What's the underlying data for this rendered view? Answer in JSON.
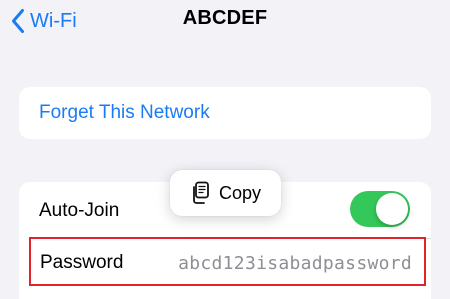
{
  "nav": {
    "back_label": "Wi-Fi",
    "title": "ABCDEF"
  },
  "forget": {
    "label": "Forget This Network"
  },
  "settings": {
    "auto_join_label": "Auto-Join",
    "auto_join_enabled": true,
    "password_label": "Password",
    "password_value": "abcd123isabadpassword"
  },
  "popover": {
    "copy_label": "Copy",
    "icon": "copy-icon"
  },
  "colors": {
    "accent": "#1a7cf5",
    "toggle_on": "#34c759",
    "highlight_border": "#e2232a",
    "background": "#f2f2f7"
  }
}
